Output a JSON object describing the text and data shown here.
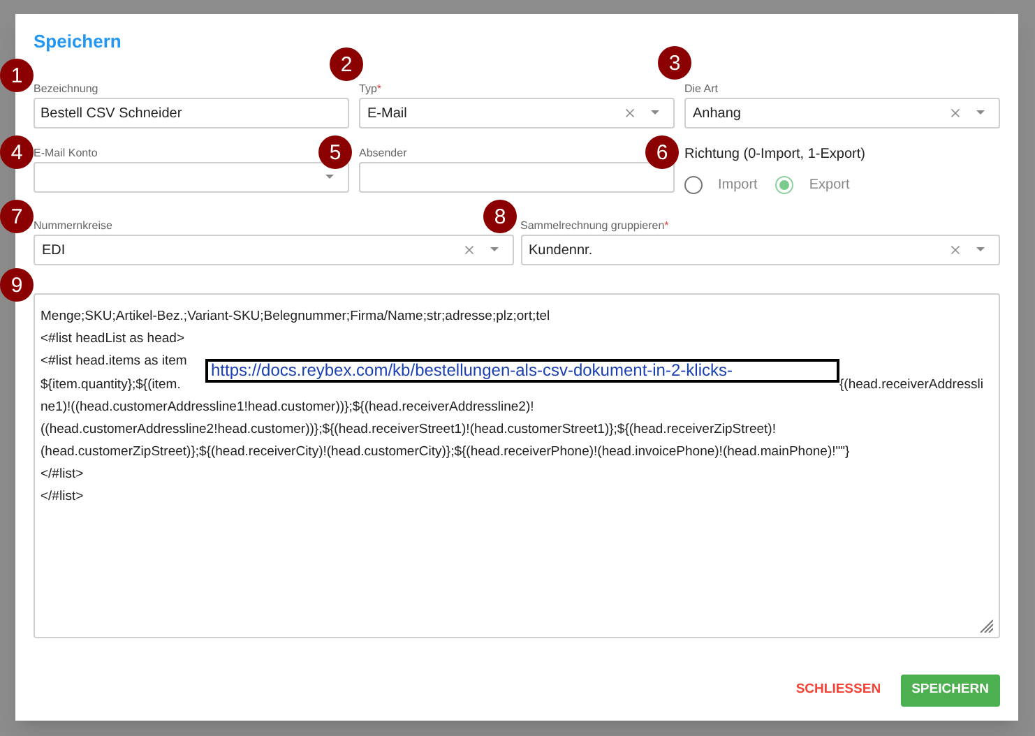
{
  "dialog": {
    "title": "Speichern"
  },
  "rows": [
    [
      {
        "kind": "text",
        "label": "Bezeichnung",
        "value": "Bestell CSV Schneider"
      },
      {
        "kind": "select",
        "label": "Typ",
        "required_mark": "*",
        "value": "E-Mail",
        "clearable": true
      },
      {
        "kind": "select",
        "label": "Die Art",
        "value": "Anhang",
        "clearable": true
      }
    ],
    [
      {
        "kind": "select",
        "label": "E-Mail Konto",
        "clearable": false
      },
      {
        "kind": "text",
        "label": "Absender"
      },
      {
        "kind": "radio",
        "label": "Richtung (0-Import, 1-Export)",
        "options": [
          {
            "label": "Import",
            "selected": false
          },
          {
            "label": "Export",
            "selected": true
          }
        ]
      }
    ],
    [
      {
        "kind": "select",
        "label": "Nummernkreise",
        "value": "EDI",
        "clearable": true
      },
      {
        "kind": "select",
        "label": "Sammelrechnung gruppieren",
        "required_mark": "*",
        "value": "Kundennr.",
        "clearable": true
      }
    ]
  ],
  "editor": {
    "lines": [
      {
        "kind": "plain",
        "text": "Menge;SKU;Artikel-Bez.;Variant-SKU;Belegnummer;Firma/Name;str;adresse;plz;ort;tel"
      },
      {
        "kind": "plain",
        "text": "<#list headList as head>"
      },
      {
        "kind": "anchor",
        "text": "<#list head.items as item"
      },
      {
        "kind": "gap",
        "parts": [
          "${item.quantity};${(item.",
          "{(head.receiverAddressli"
        ]
      },
      {
        "kind": "plain",
        "text": "ne1)!((head.customerAddressline1!head.customer))};${(head.receiverAddressline2)!"
      },
      {
        "kind": "plain",
        "text": "((head.customerAddressline2!head.customer))};${(head.receiverStreet1)!(head.customerStreet1)};${(head.receiverZipStreet)!"
      },
      {
        "kind": "plain",
        "text": "(head.customerZipStreet)};${(head.receiverCity)!(head.customerCity)};${(head.receiverPhone)!(head.invoicePhone)!(head.mainPhone)!\"\"}"
      },
      {
        "kind": "plain",
        "text": "</#list>"
      },
      {
        "kind": "plain",
        "text": "</#list>"
      }
    ]
  },
  "link_overlay": {
    "text": "https://docs.reybex.com/kb/bestellungen-als-csv-dokument-in-2-klicks-"
  },
  "buttons": [
    {
      "kind": "text",
      "label": "SCHLIESSEN"
    },
    {
      "kind": "primary",
      "label": "SPEICHERN"
    }
  ],
  "markers": [
    "1",
    "2",
    "3",
    "4",
    "5",
    "6",
    "7",
    "8",
    "9"
  ]
}
